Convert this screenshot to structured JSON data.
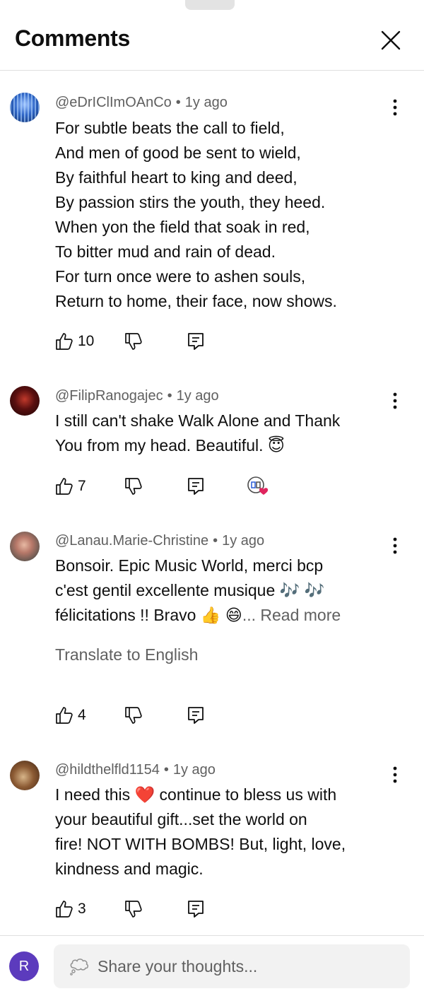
{
  "header": {
    "title": "Comments"
  },
  "comments": [
    {
      "author": "@eDrIClImOAnCo",
      "age": "1y ago",
      "lines": [
        "For subtle beats the call to field,",
        "And men of good be sent to wield,",
        "By faithful heart to king and deed,",
        "By passion stirs the youth, they heed.",
        "When yon the field that soak in red,",
        "To bitter mud and rain of dead.",
        "For turn once were to ashen souls,",
        "Return to home, their face, now shows."
      ],
      "likes": "10"
    },
    {
      "author": "@FilipRanogajec",
      "age": "1y ago",
      "lines": [
        "I still can't shake Walk Alone and Thank",
        "You from my head. Beautiful. 😇"
      ],
      "likes": "7"
    },
    {
      "author": "@Lanau.Marie-Christine",
      "age": "1y ago",
      "lines": [
        "Bonsoir. Epic Music World, merci bcp",
        "c'est gentil excellente musique 🎶 🎶",
        "félicitations !!  Bravo 👍 😄"
      ],
      "read_more": "... Read more",
      "translate": "Translate to English",
      "likes": "4"
    },
    {
      "author": "@hildthelfld1154",
      "age": "1y ago",
      "lines": [
        "I need this ❤️ continue to bless us with",
        "your beautiful gift...set the world on",
        "fire! NOT WITH BOMBS! But, light, love,",
        "kindness and magic."
      ],
      "likes": "3"
    }
  ],
  "footer": {
    "avatar_letter": "R",
    "placeholder": "Share your thoughts..."
  },
  "colors": {
    "secondary_text": "#606060",
    "divider": "#e0e0e0",
    "avatar_bg": "#5c3bbd",
    "heart": "#e0245e"
  }
}
